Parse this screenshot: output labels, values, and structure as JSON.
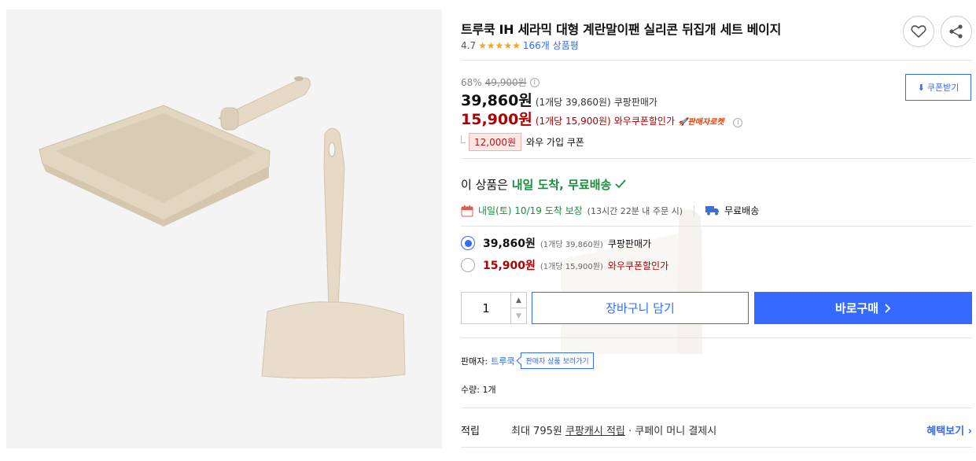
{
  "product": {
    "title": "트루쿡 IH 세라믹 대형 계란말이팬 실리콘 뒤집개 세트 베이지",
    "rating": "4.7",
    "rating_stars": 5,
    "review_count": "166개 상품평"
  },
  "price": {
    "discount_rate": "68%",
    "original_price": "49,900원",
    "sale_price": "39,860원",
    "sale_unit": "(1개당 39,860원)",
    "sale_label": "쿠팡판매가",
    "wow_price": "15,900원",
    "wow_unit": "(1개당 15,900원)",
    "wow_label": "와우쿠폰할인가",
    "rocket_badge": "판매자로켓",
    "coupon_button": "쿠폰받기",
    "wow_coupon_amount": "12,000원",
    "wow_coupon_label": "와우 가입 쿠폰"
  },
  "delivery": {
    "prefix": "이 상품은 ",
    "highlight": "내일 도착, 무료배송",
    "arrival_date": "내일(토) 10/19 도착 보장",
    "arrival_note": "(13시간 22분 내 주문 시)",
    "free_shipping": "무료배송"
  },
  "options": [
    {
      "price": "39,860원",
      "unit": "(1개당 39,860원)",
      "label": "쿠팡판매가",
      "selected": true
    },
    {
      "price": "15,900원",
      "unit": "(1개당 15,900원)",
      "label": "와우쿠폰할인가",
      "selected": false
    }
  ],
  "purchase": {
    "quantity": "1",
    "cart_label": "장바구니 담기",
    "buy_label": "바로구매"
  },
  "seller": {
    "label": "판매자:",
    "name": "트루쿡",
    "tag": "판매자 상품 보러가기"
  },
  "quantity_text": "수량: 1개",
  "points": {
    "label": "적립",
    "desc_prefix": "최대 795원 ",
    "desc_link": "쿠팡캐시 적립",
    "desc_suffix": " · 쿠페이 머니 결제시",
    "more": "혜택보기"
  },
  "colors": {
    "accent": "#346aff",
    "price_red": "#ae0000",
    "delivery_green": "#188f3c",
    "star": "#f4a623",
    "product_beige": "#e2d5c0"
  },
  "icons": [
    "heart-icon",
    "share-icon",
    "info-icon",
    "download-icon",
    "calendar-icon",
    "truck-icon",
    "check-icon",
    "chevron-right-icon"
  ]
}
